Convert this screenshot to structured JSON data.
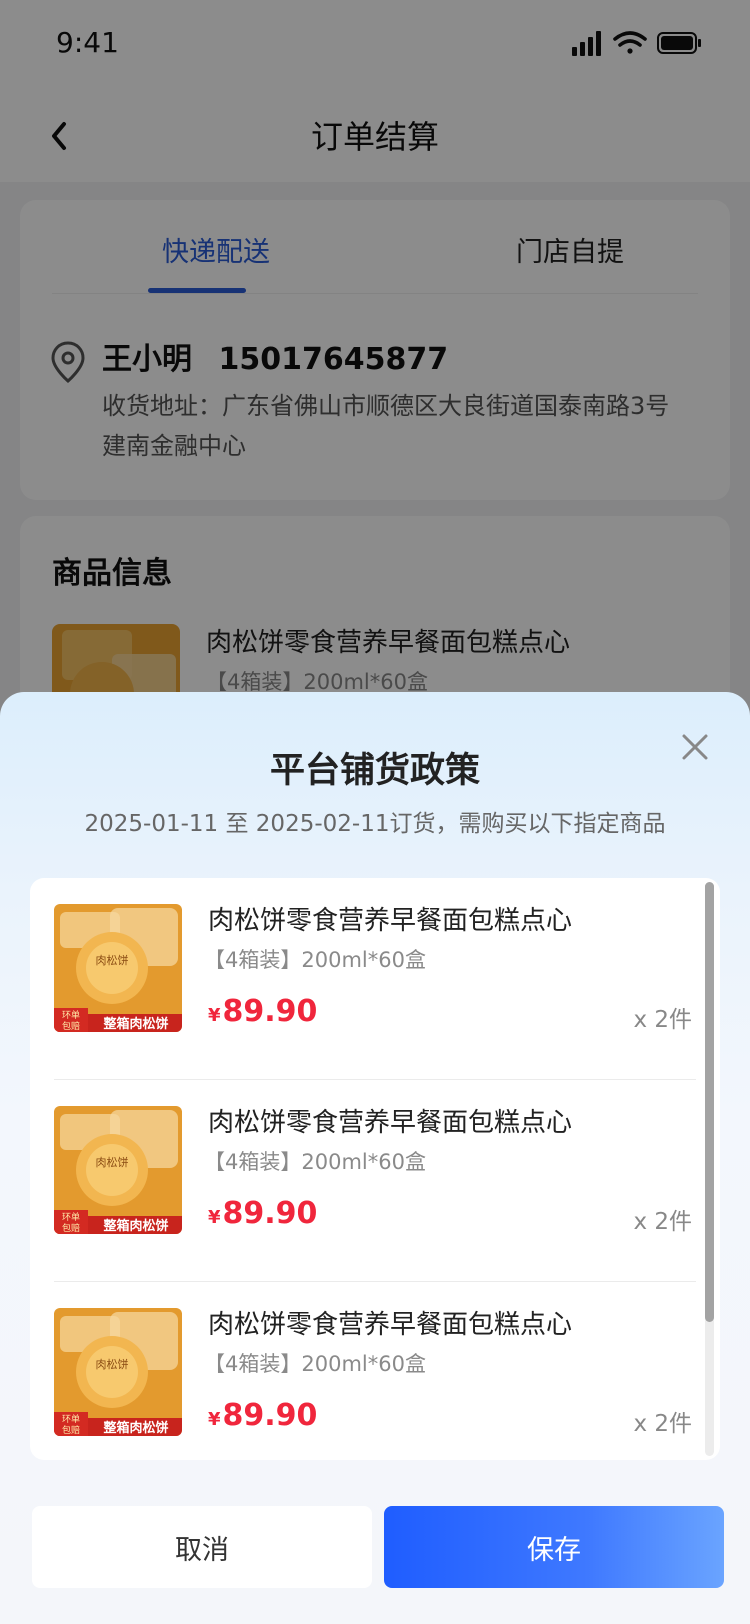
{
  "status_bar": {
    "time": "9:41"
  },
  "navbar": {
    "title": "订单结算"
  },
  "delivery": {
    "tabs": [
      "快递配送",
      "门店自提"
    ],
    "receiver_name": "王小明",
    "receiver_phone": "15017645877",
    "address": "收货地址：广东省佛山市顺德区大良街道国泰南路3号建南金融中心"
  },
  "goods": {
    "title": "商品信息",
    "name": "肉松饼零食营养早餐面包糕点心",
    "spec": "【4箱装】200ml*60盒"
  },
  "modal": {
    "title": "平台铺货政策",
    "subtitle": "2025-01-11 至 2025-02-11订货，需购买以下指定商品",
    "items": [
      {
        "name": "肉松饼零食营养早餐面包糕点心",
        "spec": "【4箱装】200ml*60盒",
        "currency": "¥",
        "price": "89.90",
        "qty": "x 2件"
      },
      {
        "name": "肉松饼零食营养早餐面包糕点心",
        "spec": "【4箱装】200ml*60盒",
        "currency": "¥",
        "price": "89.90",
        "qty": "x 2件"
      },
      {
        "name": "肉松饼零食营养早餐面包糕点心",
        "spec": "【4箱装】200ml*60盒",
        "currency": "¥",
        "price": "89.90",
        "qty": "x 2件"
      }
    ],
    "image_caption_top": "环单",
    "image_caption_bottom": "包赔",
    "image_caption_main": "整箱肉松饼",
    "image_label": "肉松饼",
    "cancel_label": "取消",
    "save_label": "保存"
  },
  "colors": {
    "accent": "#2b5cd6",
    "price": "#f0263c",
    "primary_button": "#1f5dff"
  }
}
